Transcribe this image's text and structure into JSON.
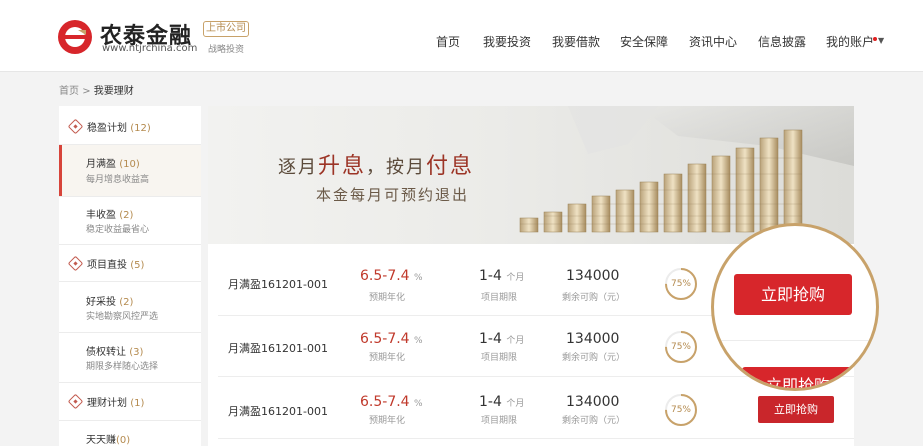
{
  "header": {
    "brand_name": "农泰金融",
    "brand_url": "www.ntjrchina.com",
    "listed_badge": "上市公司",
    "strategy": "战略投资",
    "nav": [
      "首页",
      "我要投资",
      "我要借款",
      "安全保障",
      "资讯中心",
      "信息披露",
      "我的账户"
    ],
    "account_caret": "▼",
    "colors": {
      "accent": "#d7262b",
      "gold": "#c8a26a"
    }
  },
  "breadcrumb": {
    "home": "首页",
    "sep": ">",
    "current": "我要理财"
  },
  "sidebar": {
    "categories": [
      {
        "name": "稳盈计划",
        "count": "(12)"
      },
      {
        "name": "项目直投",
        "count": "(5)"
      },
      {
        "name": "理财计划",
        "count": "(1)"
      }
    ],
    "items": [
      {
        "name": "月满盈",
        "count": "(10)",
        "desc": "每月增息收益高"
      },
      {
        "name": "丰收盈",
        "count": "(2)",
        "desc": "稳定收益最省心"
      },
      {
        "name": "好采投",
        "count": "(2)",
        "desc": "实地勘察风控严选"
      },
      {
        "name": "债权转让",
        "count": "(3)",
        "desc": "期限多样随心选择"
      },
      {
        "name": "天天赚",
        "count": "(0)",
        "desc": ""
      }
    ]
  },
  "banner": {
    "title_a": "逐月",
    "title_b": "升息",
    "title_c": "，按月",
    "title_d": "付息",
    "subtitle": "本金每月可预约退出"
  },
  "products": [
    {
      "name": "月满盈161201-001",
      "rate": "6.5-7.4",
      "rate_unit": "%",
      "rate_label": "预期年化",
      "term": "1-4",
      "term_unit": "个月",
      "term_label": "项目期限",
      "amount": "134000",
      "amount_label": "剩余可购（元）",
      "progress": "75%",
      "progress_value": 0.75,
      "button": "立即抢购"
    },
    {
      "name": "月满盈161201-001",
      "rate": "6.5-7.4",
      "rate_unit": "%",
      "rate_label": "预期年化",
      "term": "1-4",
      "term_unit": "个月",
      "term_label": "项目期限",
      "amount": "134000",
      "amount_label": "剩余可购（元）",
      "progress": "75%",
      "progress_value": 0.75,
      "button": "立即抢购"
    },
    {
      "name": "月满盈161201-001",
      "rate": "6.5-7.4",
      "rate_unit": "%",
      "rate_label": "预期年化",
      "term": "1-4",
      "term_unit": "个月",
      "term_label": "项目期限",
      "amount": "134000",
      "amount_label": "剩余可购（元）",
      "progress": "75%",
      "progress_value": 0.75,
      "button": "立即抢购"
    }
  ],
  "zoom_callout": {
    "button": "立即抢购",
    "button_partial": "立即抢购"
  }
}
